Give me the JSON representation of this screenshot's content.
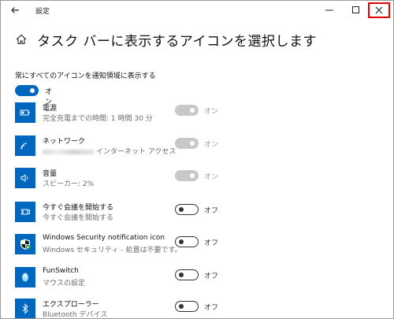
{
  "window": {
    "title": "設定",
    "page_title": "タスク バーに表示するアイコンを選択します"
  },
  "master": {
    "label": "常にすべてのアイコンを通知領域に表示する",
    "state": "オン"
  },
  "items": [
    {
      "name": "電源",
      "desc": "完全充電までの時間: 1 時間 30 分",
      "state": "オン",
      "toggle": "disabled",
      "icon": "battery-icon"
    },
    {
      "name": "ネットワーク",
      "desc": "インターネット アクセス",
      "state": "オン",
      "toggle": "disabled",
      "icon": "wifi-icon"
    },
    {
      "name": "音量",
      "desc": "スピーカー: 2%",
      "state": "オン",
      "toggle": "disabled",
      "icon": "speaker-icon"
    },
    {
      "name": "今すぐ会議を開始する",
      "desc": "今すぐ会議を開始する",
      "state": "オフ",
      "toggle": "off",
      "icon": "meet-now-icon"
    },
    {
      "name": "Windows Security notification icon",
      "desc": "Windows セキュリティ - 処置は不要です。",
      "state": "オフ",
      "toggle": "off",
      "icon": "shield-icon"
    },
    {
      "name": "FunSwitch",
      "desc": "マウスの設定",
      "state": "オフ",
      "toggle": "off",
      "icon": "mouse-icon"
    },
    {
      "name": "エクスプローラー",
      "desc": "Bluetooth デバイス",
      "state": "オフ",
      "toggle": "off",
      "icon": "bluetooth-icon"
    }
  ],
  "colors": {
    "accent": "#0067c0",
    "highlight_box": "#e60000",
    "disabled_toggle": "#c8c8c8"
  }
}
